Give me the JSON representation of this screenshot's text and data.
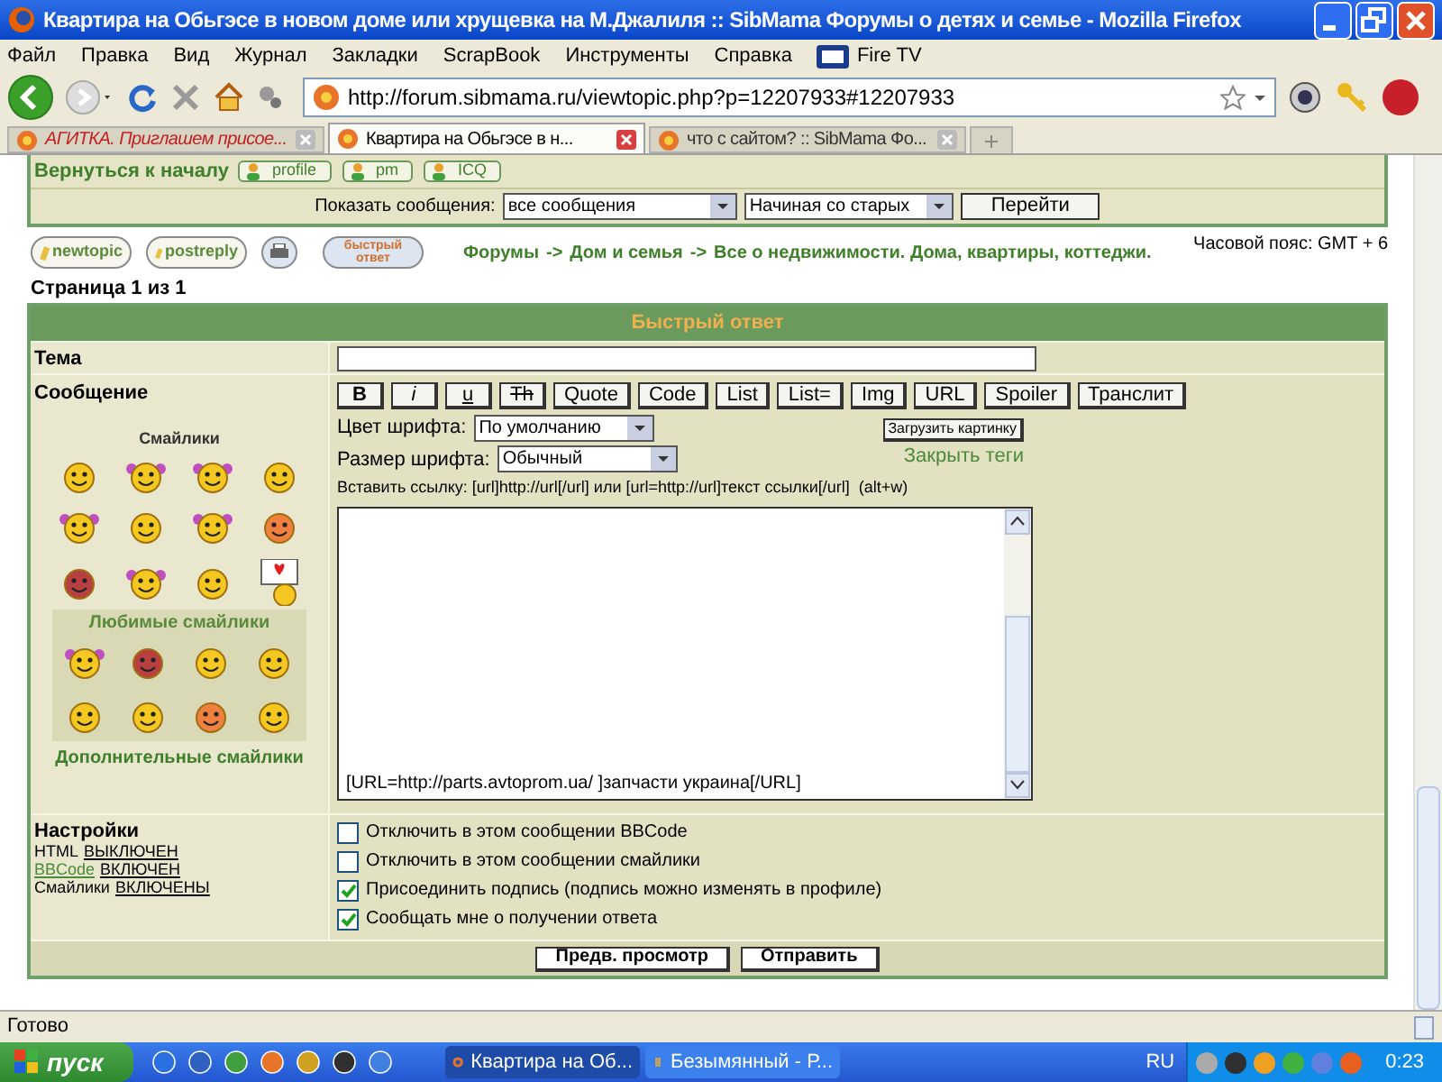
{
  "window": {
    "title": "Квартира на Обьгэсе в новом доме или хрущевка на М.Джалиля :: SibMama Форумы о детях и семье - Mozilla Firefox"
  },
  "menu": [
    "Файл",
    "Правка",
    "Вид",
    "Журнал",
    "Закладки",
    "ScrapBook",
    "Инструменты",
    "Справка",
    "Fire TV"
  ],
  "address": {
    "value": "http://forum.sibmama.ru/viewtopic.php?p=12207933#12207933"
  },
  "tabs": [
    {
      "label": "АГИТКА. Приглашем присое...",
      "selected": false
    },
    {
      "label": "Квартира на Обьгэсе в н...",
      "selected": true
    },
    {
      "label": "что с сайтом? :: SibMama Фо...",
      "selected": false
    }
  ],
  "forum": {
    "back_link": "Вернуться к началу",
    "profile_buttons": [
      "profile",
      "pm",
      "ICQ"
    ],
    "show_label": "Показать сообщения:",
    "show_select": "все сообщения",
    "order_select": "Начиная со старых",
    "go_button": "Перейти",
    "action_buttons": [
      {
        "kind": "newtopic",
        "label": "newtopic"
      },
      {
        "kind": "postreply",
        "label": "postreply"
      },
      {
        "kind": "print"
      },
      {
        "kind": "quick",
        "label": "быстрый ответ"
      }
    ],
    "breadcrumbs": [
      "Форумы",
      "Дом и семья",
      "Все о недвижимости. Дома, квартиры, коттеджи."
    ],
    "separator": "->",
    "timezone": "Часовой пояс: GMT + 6",
    "page_info": "Страница 1 из 1"
  },
  "quick_reply": {
    "title": "Быстрый ответ",
    "subject_label": "Тема",
    "message_label": "Сообщение",
    "smileys_title": "Смайлики",
    "favorites_title": "Любимые смайлики",
    "more_smileys": "Дополнительные смайлики",
    "format_buttons": [
      "B",
      "i",
      "u",
      "Th",
      "Quote",
      "Code",
      "List",
      "List=",
      "Img",
      "URL",
      "Spoiler",
      "Транслит"
    ],
    "font_color_label": "Цвет шрифта:",
    "font_color": "По умолчанию",
    "font_size_label": "Размер шрифта:",
    "font_size": "Обычный",
    "upload_button": "Загрузить картинку",
    "close_tags": "Закрыть теги",
    "link_hint": "Вставить ссылку: [url]http://url[/url] или [url=http://url]текст ссылки[/url]  (alt+w)",
    "message": "[URL=http://parts.avtoprom.ua/ ]запчасти украина[/URL]",
    "settings_title": "Настройки",
    "settings": [
      {
        "label": "HTML",
        "value": "ВЫКЛЮЧЕН"
      },
      {
        "label": "BBCode",
        "value": "ВКЛЮЧЕН"
      },
      {
        "label": "Смайлики",
        "value": "ВКЛЮЧЕНЫ"
      }
    ],
    "options": [
      {
        "label": "Отключить в этом сообщении BBCode",
        "checked": false
      },
      {
        "label": "Отключить в этом сообщении смайлики",
        "checked": false
      },
      {
        "label": "Присоединить подпись (подпись можно изменять в профиле)",
        "checked": true
      },
      {
        "label": "Сообщать мне о получении ответа",
        "checked": true
      }
    ],
    "buttons": [
      "Предв. просмотр",
      "Отправить"
    ]
  },
  "status_bar": "Готово",
  "taskbar": {
    "start": "пуск",
    "tasks": [
      {
        "label": "Квартира на Об...",
        "selected": true
      },
      {
        "label": "Безымянный - Р...",
        "selected": false
      }
    ],
    "lang": "RU",
    "clock": "0:23"
  }
}
